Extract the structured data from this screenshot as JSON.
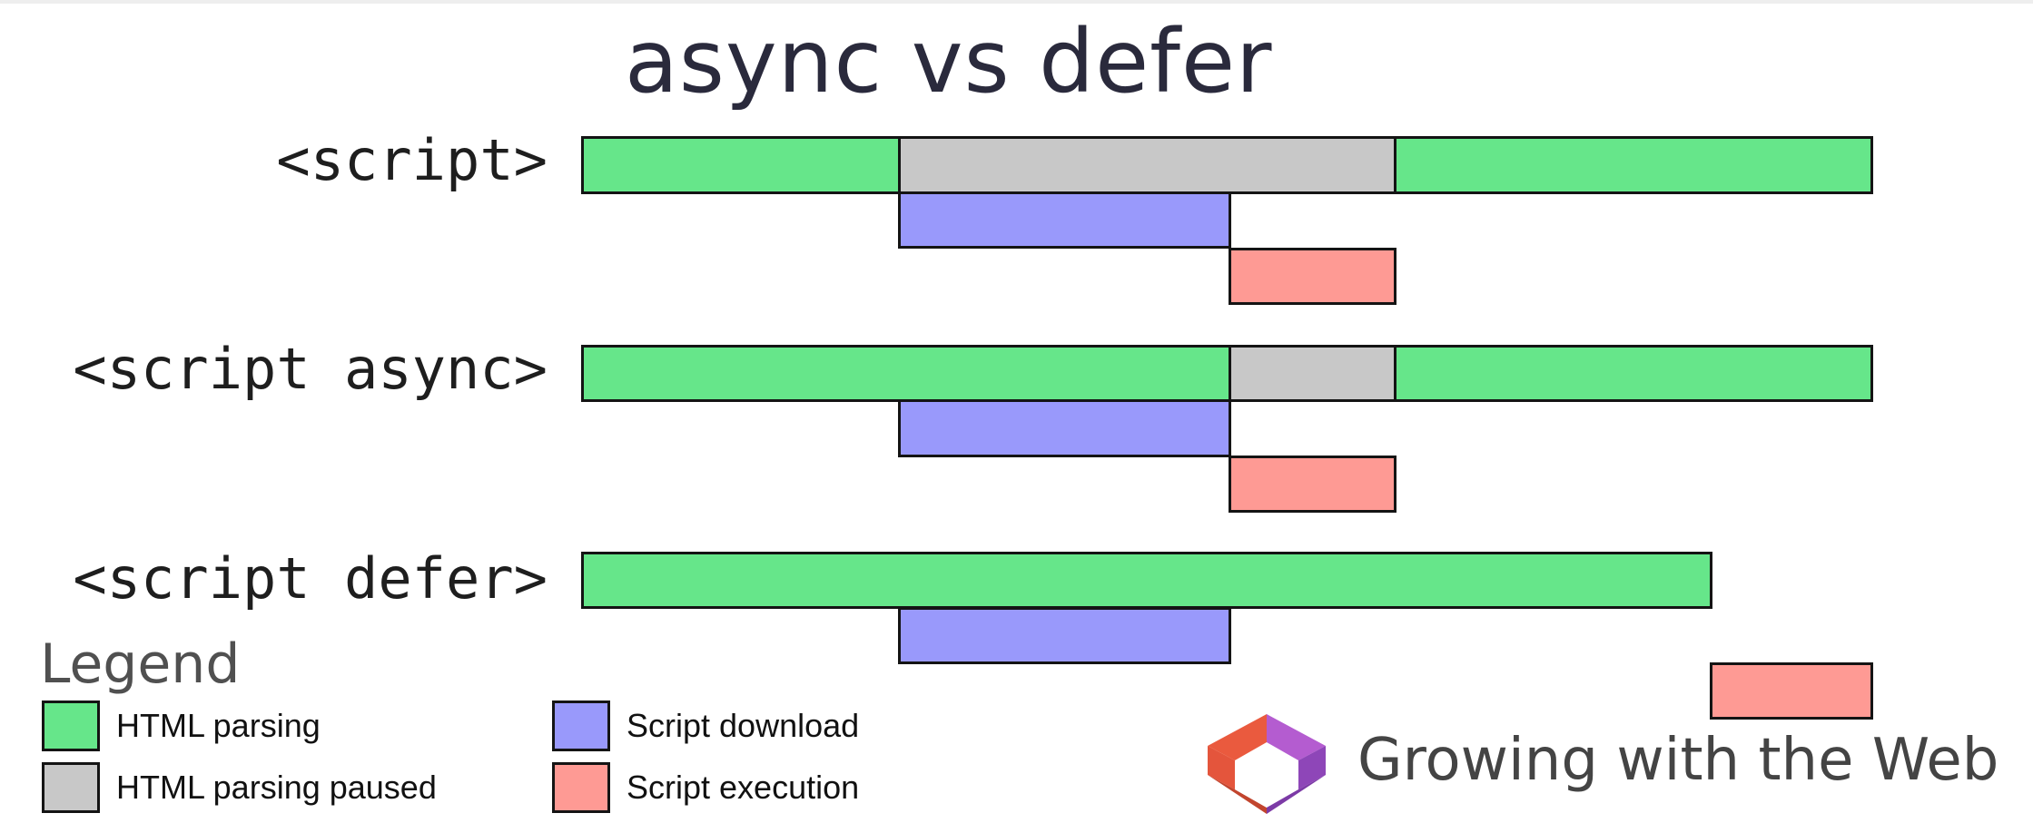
{
  "title": "async vs defer",
  "rows": [
    {
      "label": "<script>"
    },
    {
      "label": "<script async>"
    },
    {
      "label": "<script defer>"
    }
  ],
  "legend": {
    "title": "Legend",
    "items": [
      {
        "label": "HTML parsing",
        "color": "#66e68a"
      },
      {
        "label": "HTML parsing paused",
        "color": "#c8c8c8"
      },
      {
        "label": "Script download",
        "color": "#9999fb"
      },
      {
        "label": "Script execution",
        "color": "#fe9a94"
      }
    ]
  },
  "brand": {
    "text": "Growing with the Web",
    "logo_icon": "cube-logo-icon",
    "colors": [
      "#e4553c",
      "#a855c8",
      "#c2452e",
      "#7c3aa6"
    ]
  }
}
